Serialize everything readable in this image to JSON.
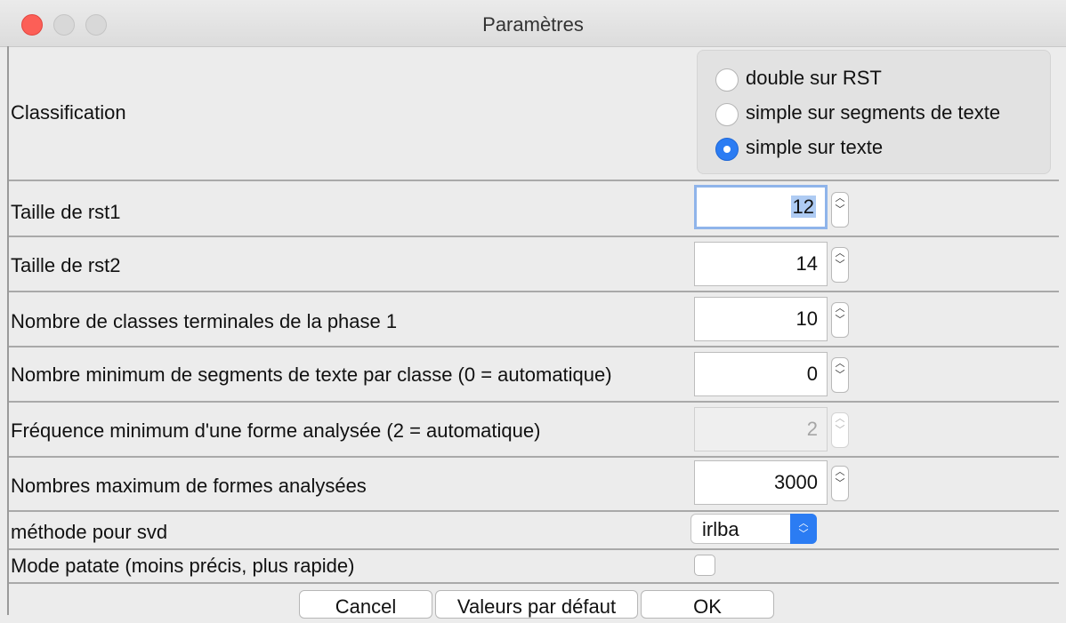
{
  "window": {
    "title": "Paramètres"
  },
  "classification": {
    "label": "Classification",
    "options": [
      {
        "label": "double sur RST",
        "checked": false
      },
      {
        "label": "simple sur segments de texte",
        "checked": false
      },
      {
        "label": "simple sur texte",
        "checked": true
      }
    ]
  },
  "fields": [
    {
      "label": "Taille de rst1",
      "value": "12",
      "focused": true,
      "disabled": false
    },
    {
      "label": "Taille de rst2",
      "value": "14",
      "focused": false,
      "disabled": false
    },
    {
      "label": "Nombre de classes terminales de la phase 1",
      "value": "10",
      "focused": false,
      "disabled": false
    },
    {
      "label": "Nombre minimum de segments de texte par classe (0 = automatique)",
      "value": "0",
      "focused": false,
      "disabled": false
    },
    {
      "label": "Fréquence minimum d'une forme analysée (2 = automatique)",
      "value": "2",
      "focused": false,
      "disabled": true
    },
    {
      "label": "Nombres maximum de formes analysées",
      "value": "3000",
      "focused": false,
      "disabled": false
    }
  ],
  "svd": {
    "label": "méthode pour svd",
    "selected": "irlba"
  },
  "patate": {
    "label": "Mode patate (moins précis, plus rapide)",
    "checked": false
  },
  "buttons": {
    "cancel": "Cancel",
    "defaults": "Valeurs par défaut",
    "ok": "OK"
  },
  "colors": {
    "accent": "#2b7cf3",
    "close": "#fc5f57",
    "selection": "#aecbf3"
  }
}
